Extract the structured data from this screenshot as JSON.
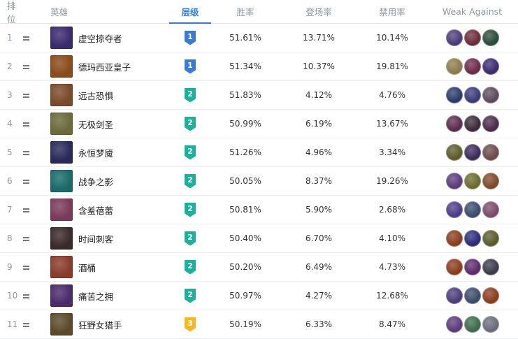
{
  "headers": {
    "rank": "排位",
    "hero": "英雄",
    "tier": "层级",
    "win_rate": "胜率",
    "pick_rate": "登场率",
    "ban_rate": "禁用率",
    "weak_against": "Weak Against"
  },
  "tier_colors": {
    "1": "#3a7bd5",
    "2": "#1ab29a",
    "3": "#f5b820"
  },
  "rows": [
    {
      "rank": "1",
      "name": "虚空掠夺者",
      "tier": "1",
      "win": "51.61%",
      "pick": "13.71%",
      "ban": "10.14%",
      "portrait": "#3a2a6e",
      "weak": [
        "#4a3a7a",
        "#6b2a3a",
        "#2a4a3a"
      ]
    },
    {
      "rank": "2",
      "name": "德玛西亚皇子",
      "tier": "1",
      "win": "51.34%",
      "pick": "10.37%",
      "ban": "19.81%",
      "portrait": "#8a4a1a",
      "weak": [
        "#8a7a4a",
        "#6a2a4a",
        "#3a2a6e"
      ]
    },
    {
      "rank": "3",
      "name": "远古恐惧",
      "tier": "2",
      "win": "51.83%",
      "pick": "4.12%",
      "ban": "4.76%",
      "portrait": "#7a4a2a",
      "weak": [
        "#2a3a6a",
        "#3a3a7a",
        "#5a4a5a"
      ]
    },
    {
      "rank": "4",
      "name": "无极剑圣",
      "tier": "2",
      "win": "50.99%",
      "pick": "6.19%",
      "ban": "13.67%",
      "portrait": "#6a6a3a",
      "weak": [
        "#5a2a4a",
        "#3a2a3a",
        "#4a2a4a"
      ]
    },
    {
      "rank": "5",
      "name": "永恒梦魇",
      "tier": "2",
      "win": "51.26%",
      "pick": "4.96%",
      "ban": "3.34%",
      "portrait": "#2a2a5a",
      "weak": [
        "#5a5a2a",
        "#3a2a5a",
        "#6a4a4a"
      ]
    },
    {
      "rank": "6",
      "name": "战争之影",
      "tier": "2",
      "win": "50.05%",
      "pick": "8.37%",
      "ban": "19.26%",
      "portrait": "#1a6a6a",
      "weak": [
        "#5a3a7a",
        "#6a6a2a",
        "#7a4a2a"
      ]
    },
    {
      "rank": "7",
      "name": "含羞蓓蕾",
      "tier": "2",
      "win": "50.81%",
      "pick": "5.90%",
      "ban": "2.68%",
      "portrait": "#7a3a5a",
      "weak": [
        "#4a3a8a",
        "#3a4a6a",
        "#7a4a6a"
      ]
    },
    {
      "rank": "8",
      "name": "时间刺客",
      "tier": "2",
      "win": "50.40%",
      "pick": "6.70%",
      "ban": "4.10%",
      "portrait": "#3a2a2a",
      "weak": [
        "#8a3a1a",
        "#2a2a7a",
        "#5a5a2a"
      ]
    },
    {
      "rank": "9",
      "name": "酒桶",
      "tier": "2",
      "win": "50.20%",
      "pick": "6.49%",
      "ban": "4.73%",
      "portrait": "#8a3a2a",
      "weak": [
        "#8a3a1a",
        "#5a2a6a",
        "#3a3a4a"
      ]
    },
    {
      "rank": "10",
      "name": "痛苦之拥",
      "tier": "2",
      "win": "50.97%",
      "pick": "4.27%",
      "ban": "12.68%",
      "portrait": "#4a2a6a",
      "weak": [
        "#4a3a7a",
        "#3a4a6a",
        "#8a3a1a"
      ]
    },
    {
      "rank": "11",
      "name": "狂野女猎手",
      "tier": "3",
      "win": "50.19%",
      "pick": "6.33%",
      "ban": "8.47%",
      "portrait": "#5a4a2a",
      "weak": [
        "#5a3a7a",
        "#3a6a4a",
        "#6a6a7a"
      ]
    }
  ]
}
